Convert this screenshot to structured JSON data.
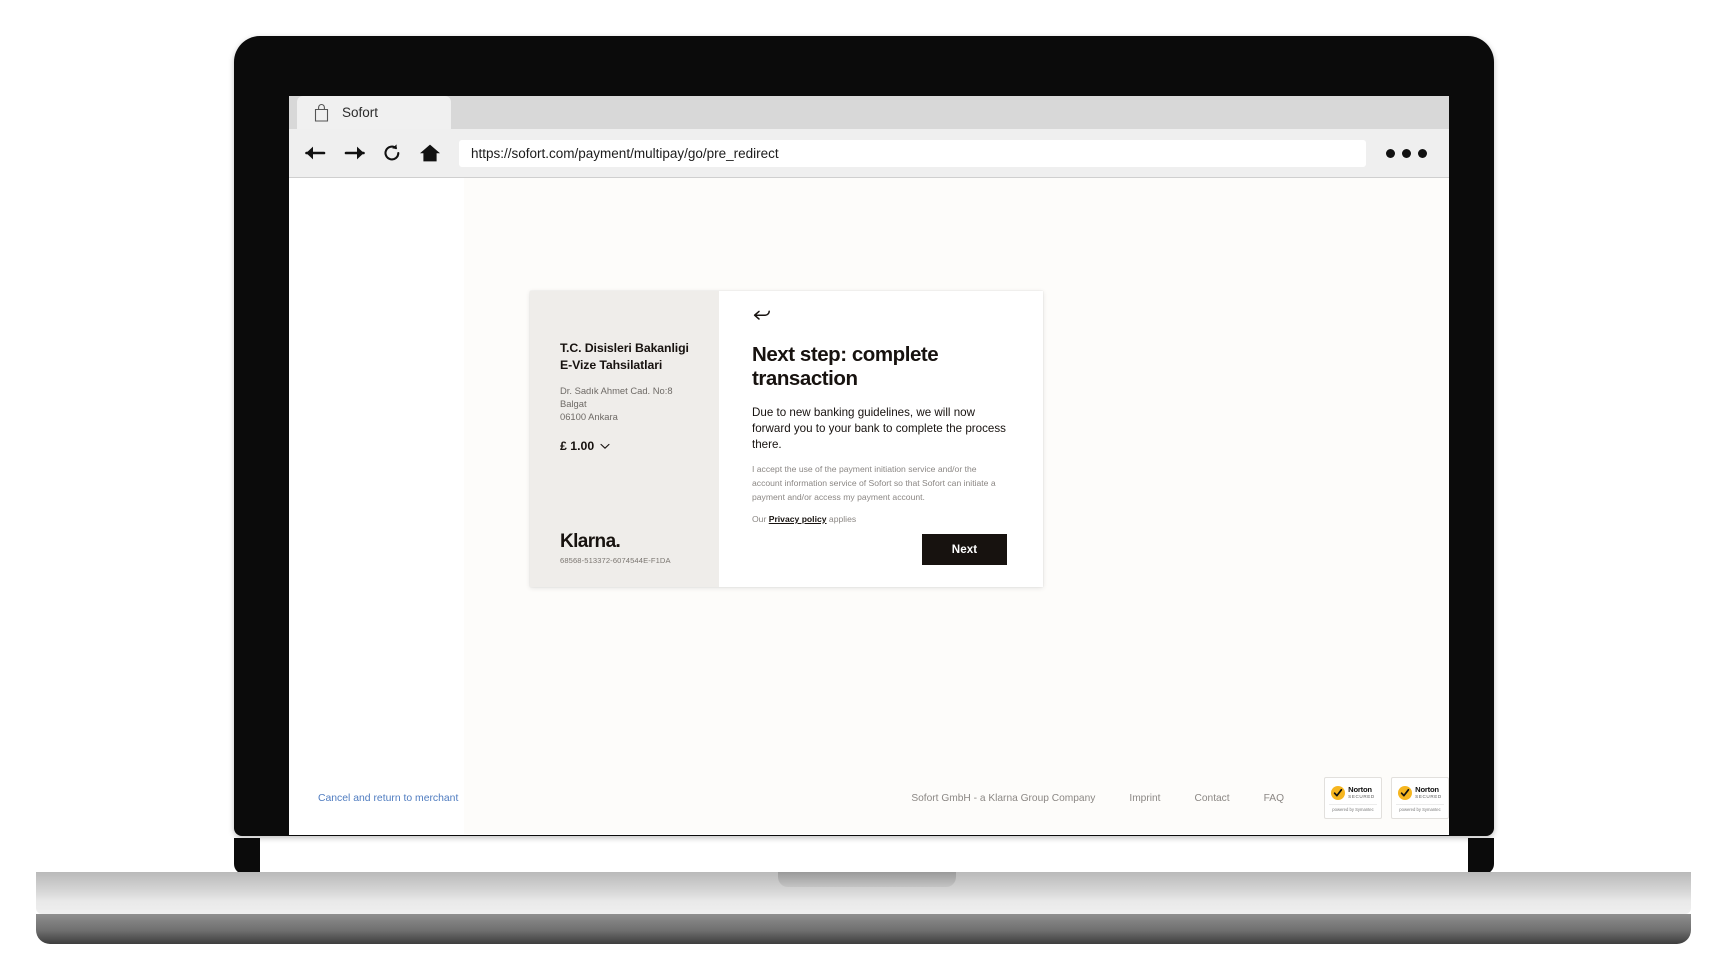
{
  "browser": {
    "tab": {
      "title": "Sofort",
      "favicon": "shopping-bag-icon"
    },
    "nav": {
      "back": "back-arrow-icon",
      "forward": "forward-arrow-icon",
      "reload": "reload-icon",
      "home": "home-icon",
      "menu": "kebab-menu-icon"
    },
    "url": "https://sofort.com/payment/multipay/go/pre_redirect"
  },
  "checkout": {
    "summary": {
      "merchant_name": "T.C. Disisleri Bakanligi E-Vize Tahsilatlari",
      "merchant_address_line1": "Dr. Sadık Ahmet Cad. No:8 Balgat",
      "merchant_address_line2": "06100 Ankara",
      "amount": "£ 1.00",
      "amount_toggle_icon": "chevron-down-icon",
      "brand": "Klarna.",
      "reference": "68568-513372-6074544E-F1DA"
    },
    "panel": {
      "back_icon": "back-return-arrow-icon",
      "headline": "Next step: complete transaction",
      "lede": "Due to new banking guidelines, we will now forward you to your bank to complete the process there.",
      "fineprint": "I accept the use of the payment initiation service and/or the account information service of Sofort so that Sofort can initiate a payment and/or access my payment account.",
      "privacy_prefix": "Our ",
      "privacy_link": "Privacy policy",
      "privacy_suffix": " applies",
      "next_label": "Next"
    }
  },
  "footer": {
    "cancel_link": "Cancel and return to merchant",
    "company": "Sofort GmbH - a Klarna Group Company",
    "links": [
      {
        "label": "Imprint"
      },
      {
        "label": "Contact"
      },
      {
        "label": "FAQ"
      }
    ],
    "badges": [
      {
        "name": "Norton",
        "status": "SECURED",
        "powered": "powered by Symantec"
      },
      {
        "name": "Norton",
        "status": "SECURED",
        "powered": "powered by Symantec"
      }
    ]
  },
  "colors": {
    "accent_dark": "#17120f",
    "panel_bg": "#efedea",
    "link_blue": "#4f7cc0",
    "muted": "#8b8784",
    "norton_gold": "#f6b620"
  }
}
